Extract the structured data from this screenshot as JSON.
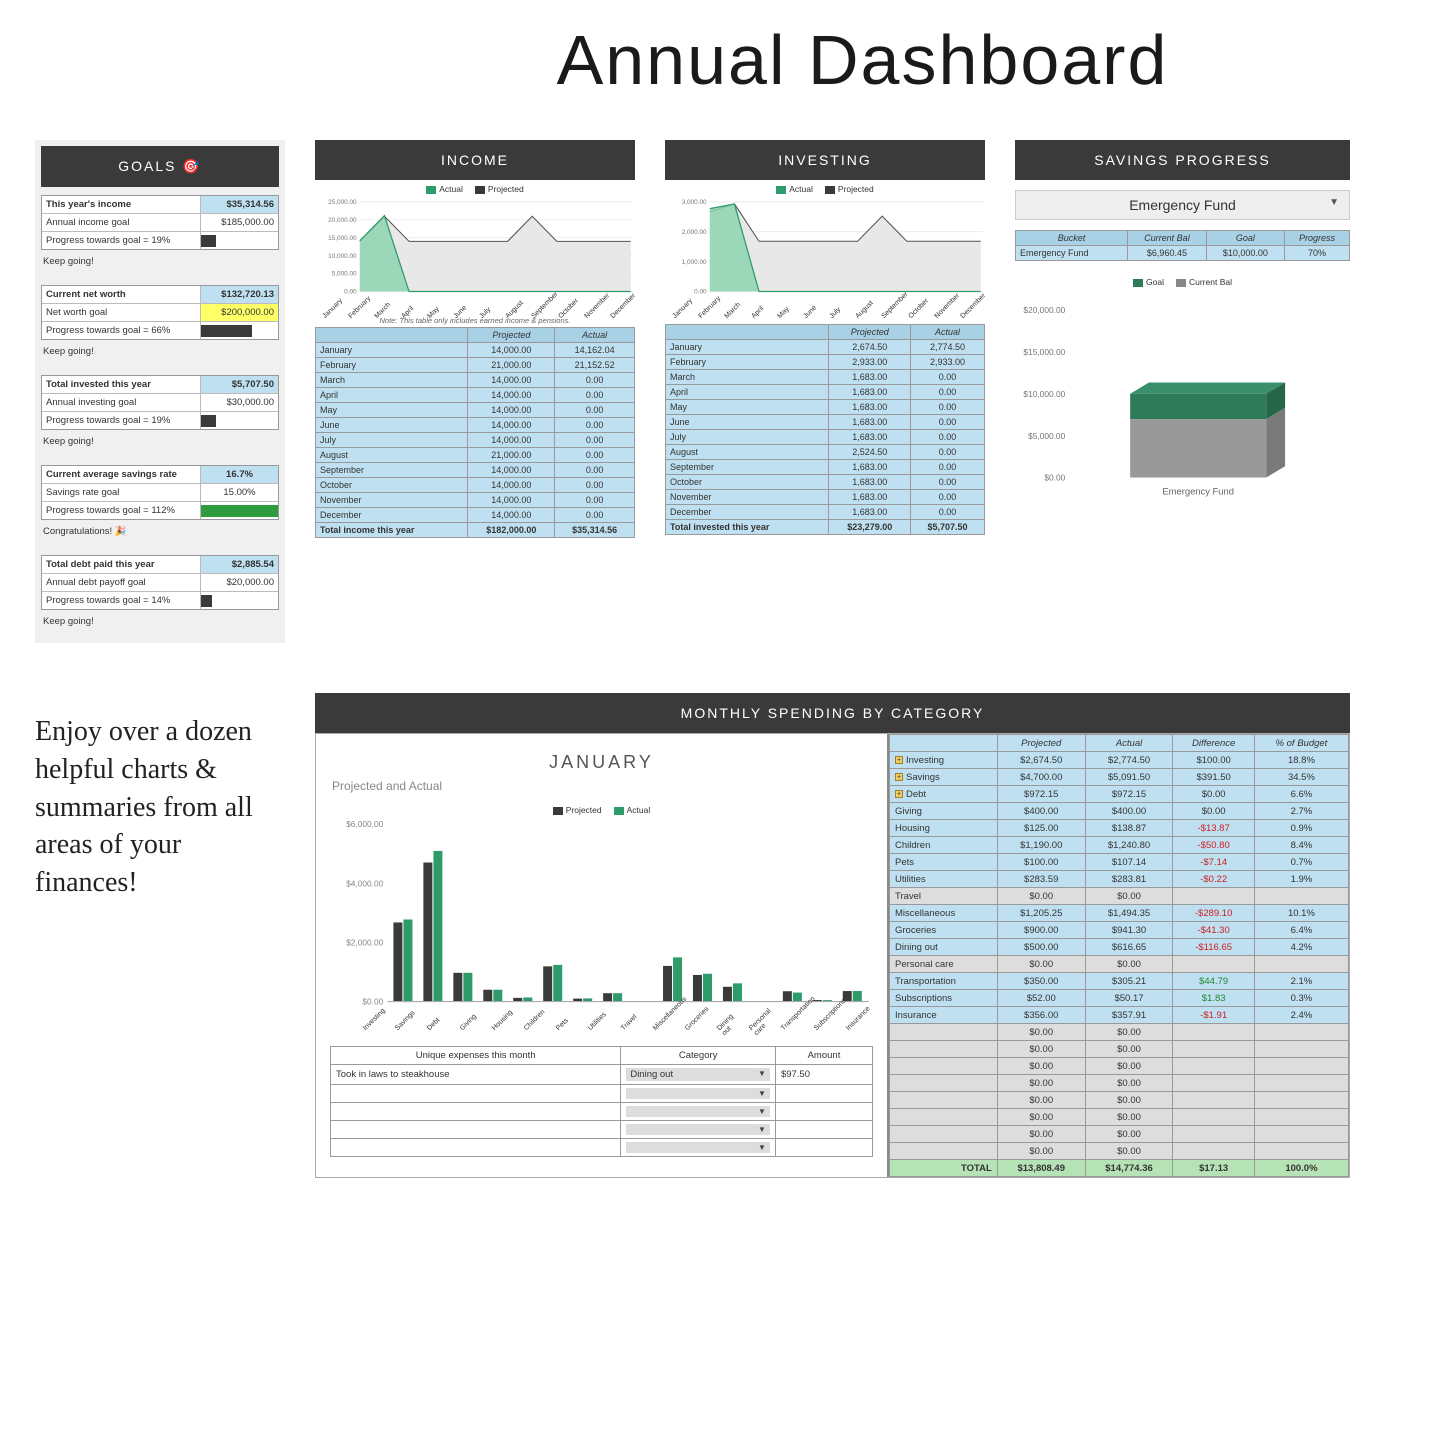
{
  "page_title": "Annual Dashboard",
  "caption": "Enjoy over a dozen helpful charts & summaries from all areas of your finances!",
  "months": [
    "January",
    "February",
    "March",
    "April",
    "May",
    "June",
    "July",
    "August",
    "September",
    "October",
    "November",
    "December"
  ],
  "goals": {
    "header": "GOALS 🎯",
    "blocks": [
      {
        "rows": [
          {
            "label": "This year's income",
            "value": "$35,314.56",
            "bold": true,
            "value_class": "bg-blue"
          },
          {
            "label": "Annual income goal",
            "value": "$185,000.00"
          },
          {
            "label": "Progress towards goal = 19%",
            "bar": true,
            "bar_pct": 19,
            "bar_class": "bg-dark"
          }
        ],
        "msg": "Keep going!"
      },
      {
        "rows": [
          {
            "label": "Current net worth",
            "value": "$132,720.13",
            "bold": true,
            "value_class": "bg-blue"
          },
          {
            "label": "Net worth goal",
            "value": "$200,000.00",
            "value_class": "bg-yellow"
          },
          {
            "label": "Progress towards goal = 66%",
            "bar": true,
            "bar_pct": 66,
            "bar_class": "bg-dark"
          }
        ],
        "msg": "Keep going!"
      },
      {
        "rows": [
          {
            "label": "Total invested this year",
            "value": "$5,707.50",
            "bold": true,
            "value_class": "bg-blue"
          },
          {
            "label": "Annual investing goal",
            "value": "$30,000.00"
          },
          {
            "label": "Progress towards goal = 19%",
            "bar": true,
            "bar_pct": 19,
            "bar_class": "bg-dark"
          }
        ],
        "msg": "Keep going!"
      },
      {
        "rows": [
          {
            "label": "Current average savings rate",
            "value": "16.7%",
            "bold": true,
            "value_class": "bg-blue",
            "center": true
          },
          {
            "label": "Savings rate goal",
            "value": "15.00%",
            "center": true
          },
          {
            "label": "Progress towards goal = 112%",
            "bar": true,
            "bar_pct": 100,
            "bar_class": "bg-green"
          }
        ],
        "msg": "Congratulations! 🎉"
      },
      {
        "rows": [
          {
            "label": "Total debt paid this year",
            "value": "$2,885.54",
            "bold": true,
            "value_class": "bg-blue"
          },
          {
            "label": "Annual debt payoff goal",
            "value": "$20,000.00"
          },
          {
            "label": "Progress towards goal = 14%",
            "bar": true,
            "bar_pct": 14,
            "bar_class": "bg-dark"
          }
        ],
        "msg": "Keep going!"
      }
    ]
  },
  "income": {
    "header": "INCOME",
    "legend": [
      "Actual",
      "Projected"
    ],
    "note": "Note: This table only includes earned income & pensions.",
    "cols": [
      "",
      "Projected",
      "Actual"
    ],
    "rows": [
      [
        "January",
        "14,000.00",
        "14,162.04"
      ],
      [
        "February",
        "21,000.00",
        "21,152.52"
      ],
      [
        "March",
        "14,000.00",
        "0.00"
      ],
      [
        "April",
        "14,000.00",
        "0.00"
      ],
      [
        "May",
        "14,000.00",
        "0.00"
      ],
      [
        "June",
        "14,000.00",
        "0.00"
      ],
      [
        "July",
        "14,000.00",
        "0.00"
      ],
      [
        "August",
        "21,000.00",
        "0.00"
      ],
      [
        "September",
        "14,000.00",
        "0.00"
      ],
      [
        "October",
        "14,000.00",
        "0.00"
      ],
      [
        "November",
        "14,000.00",
        "0.00"
      ],
      [
        "December",
        "14,000.00",
        "0.00"
      ]
    ],
    "total": [
      "Total income this year",
      "$182,000.00",
      "$35,314.56"
    ],
    "chart_data": {
      "type": "area",
      "x": [
        "Jan",
        "Feb",
        "Mar",
        "Apr",
        "May",
        "Jun",
        "Jul",
        "Aug",
        "Sep",
        "Oct",
        "Nov",
        "Dec"
      ],
      "series": [
        {
          "name": "Actual",
          "values": [
            14162,
            21152,
            0,
            0,
            0,
            0,
            0,
            0,
            0,
            0,
            0,
            0
          ]
        },
        {
          "name": "Projected",
          "values": [
            14000,
            21000,
            14000,
            14000,
            14000,
            14000,
            14000,
            21000,
            14000,
            14000,
            14000,
            14000
          ]
        }
      ],
      "ylim": [
        0,
        25000
      ],
      "y_ticks": [
        "0.00",
        "5,000.00",
        "10,000.00",
        "15,000.00",
        "20,000.00",
        "25,000.00"
      ]
    }
  },
  "investing": {
    "header": "INVESTING",
    "legend": [
      "Actual",
      "Projected"
    ],
    "cols": [
      "",
      "Projected",
      "Actual"
    ],
    "rows": [
      [
        "January",
        "2,674.50",
        "2,774.50"
      ],
      [
        "February",
        "2,933.00",
        "2,933.00"
      ],
      [
        "March",
        "1,683.00",
        "0.00"
      ],
      [
        "April",
        "1,683.00",
        "0.00"
      ],
      [
        "May",
        "1,683.00",
        "0.00"
      ],
      [
        "June",
        "1,683.00",
        "0.00"
      ],
      [
        "July",
        "1,683.00",
        "0.00"
      ],
      [
        "August",
        "2,524.50",
        "0.00"
      ],
      [
        "September",
        "1,683.00",
        "0.00"
      ],
      [
        "October",
        "1,683.00",
        "0.00"
      ],
      [
        "November",
        "1,683.00",
        "0.00"
      ],
      [
        "December",
        "1,683.00",
        "0.00"
      ]
    ],
    "total": [
      "Total invested this year",
      "$23,279.00",
      "$5,707.50"
    ],
    "chart_data": {
      "type": "area",
      "x": [
        "Jan",
        "Feb",
        "Mar",
        "Apr",
        "May",
        "Jun",
        "Jul",
        "Aug",
        "Sep",
        "Oct",
        "Nov",
        "Dec"
      ],
      "series": [
        {
          "name": "Actual",
          "values": [
            2774,
            2933,
            0,
            0,
            0,
            0,
            0,
            0,
            0,
            0,
            0,
            0
          ]
        },
        {
          "name": "Projected",
          "values": [
            2674,
            2933,
            1683,
            1683,
            1683,
            1683,
            1683,
            2524,
            1683,
            1683,
            1683,
            1683
          ]
        }
      ],
      "ylim": [
        0,
        3000
      ],
      "y_ticks": [
        "0.00",
        "1,000.00",
        "2,000.00",
        "3,000.00"
      ]
    }
  },
  "savings": {
    "header": "SAVINGS PROGRESS",
    "selector": "Emergency Fund",
    "cols": [
      "Bucket",
      "Current Bal",
      "Goal",
      "Progress"
    ],
    "rows": [
      [
        "Emergency Fund",
        "$6,960.45",
        "$10,000.00",
        "70%"
      ]
    ],
    "legend": [
      "Goal",
      "Current Bal"
    ],
    "chart_data": {
      "type": "bar",
      "categories": [
        "Emergency Fund"
      ],
      "series": [
        {
          "name": "Goal",
          "value": 10000
        },
        {
          "name": "Current Bal",
          "value": 6960.45
        }
      ],
      "ylim": [
        0,
        20000
      ],
      "y_ticks": [
        "$0.00",
        "$5,000.00",
        "$10,000.00",
        "$15,000.00",
        "$20,000.00"
      ]
    }
  },
  "spending": {
    "header": "MONTHLY SPENDING BY CATEGORY",
    "month": "JANUARY",
    "subtitle": "Projected and Actual",
    "legend": [
      "Projected",
      "Actual"
    ],
    "cols": [
      "",
      "Projected",
      "Actual",
      "Difference",
      "% of Budget"
    ],
    "rows": [
      {
        "m": 1,
        "c": "Investing",
        "p": "$2,674.50",
        "a": "$2,774.50",
        "d": "$100.00",
        "b": "18.8%"
      },
      {
        "m": 1,
        "c": "Savings",
        "p": "$4,700.00",
        "a": "$5,091.50",
        "d": "$391.50",
        "b": "34.5%"
      },
      {
        "m": 1,
        "c": "Debt",
        "p": "$972.15",
        "a": "$972.15",
        "d": "$0.00",
        "b": "6.6%"
      },
      {
        "m": 0,
        "c": "Giving",
        "p": "$400.00",
        "a": "$400.00",
        "d": "$0.00",
        "b": "2.7%"
      },
      {
        "m": 0,
        "c": "Housing",
        "p": "$125.00",
        "a": "$138.87",
        "d": "-$13.87",
        "dn": 1,
        "b": "0.9%"
      },
      {
        "m": 0,
        "c": "Children",
        "p": "$1,190.00",
        "a": "$1,240.80",
        "d": "-$50.80",
        "dn": 1,
        "b": "8.4%"
      },
      {
        "m": 0,
        "c": "Pets",
        "p": "$100.00",
        "a": "$107.14",
        "d": "-$7.14",
        "dn": 1,
        "b": "0.7%"
      },
      {
        "m": 0,
        "c": "Utilities",
        "p": "$283.59",
        "a": "$283.81",
        "d": "-$0.22",
        "dn": 1,
        "b": "1.9%"
      },
      {
        "m": 0,
        "grey": 1,
        "c": "Travel",
        "p": "$0.00",
        "a": "$0.00",
        "d": "",
        "b": ""
      },
      {
        "m": 0,
        "c": "Miscellaneous",
        "p": "$1,205.25",
        "a": "$1,494.35",
        "d": "-$289.10",
        "dn": 1,
        "b": "10.1%"
      },
      {
        "m": 0,
        "c": "Groceries",
        "p": "$900.00",
        "a": "$941.30",
        "d": "-$41.30",
        "dn": 1,
        "b": "6.4%"
      },
      {
        "m": 0,
        "c": "Dining out",
        "p": "$500.00",
        "a": "$616.65",
        "d": "-$116.65",
        "dn": 1,
        "b": "4.2%"
      },
      {
        "m": 0,
        "grey": 1,
        "c": "Personal care",
        "p": "$0.00",
        "a": "$0.00",
        "d": "",
        "b": ""
      },
      {
        "m": 0,
        "c": "Transportation",
        "p": "$350.00",
        "a": "$305.21",
        "d": "$44.79",
        "dp": 1,
        "b": "2.1%"
      },
      {
        "m": 0,
        "c": "Subscriptions",
        "p": "$52.00",
        "a": "$50.17",
        "d": "$1.83",
        "dp": 1,
        "b": "0.3%"
      },
      {
        "m": 0,
        "c": "Insurance",
        "p": "$356.00",
        "a": "$357.91",
        "d": "-$1.91",
        "dn": 1,
        "b": "2.4%"
      },
      {
        "m": 0,
        "grey": 1,
        "c": "",
        "p": "$0.00",
        "a": "$0.00",
        "d": "",
        "b": ""
      },
      {
        "m": 0,
        "grey": 1,
        "c": "",
        "p": "$0.00",
        "a": "$0.00",
        "d": "",
        "b": ""
      },
      {
        "m": 0,
        "grey": 1,
        "c": "",
        "p": "$0.00",
        "a": "$0.00",
        "d": "",
        "b": ""
      },
      {
        "m": 0,
        "grey": 1,
        "c": "",
        "p": "$0.00",
        "a": "$0.00",
        "d": "",
        "b": ""
      },
      {
        "m": 0,
        "grey": 1,
        "c": "",
        "p": "$0.00",
        "a": "$0.00",
        "d": "",
        "b": ""
      },
      {
        "m": 0,
        "grey": 1,
        "c": "",
        "p": "$0.00",
        "a": "$0.00",
        "d": "",
        "b": ""
      },
      {
        "m": 0,
        "grey": 1,
        "c": "",
        "p": "$0.00",
        "a": "$0.00",
        "d": "",
        "b": ""
      },
      {
        "m": 0,
        "grey": 1,
        "c": "",
        "p": "$0.00",
        "a": "$0.00",
        "d": "",
        "b": ""
      }
    ],
    "total": {
      "label": "TOTAL",
      "p": "$13,808.49",
      "a": "$14,774.36",
      "d": "$17.13",
      "b": "100.0%"
    },
    "chart_data": {
      "type": "bar",
      "categories": [
        "Investing",
        "Savings",
        "Debt",
        "Giving",
        "Housing",
        "Children",
        "Pets",
        "Utilities",
        "Travel",
        "Miscellaneous",
        "Groceries",
        "Dining out",
        "Personal care",
        "Transportation",
        "Subscriptions",
        "Insurance"
      ],
      "series": [
        {
          "name": "Projected",
          "values": [
            2674.5,
            4700.0,
            972.15,
            400.0,
            125.0,
            1190.0,
            100.0,
            283.59,
            0,
            1205.25,
            900.0,
            500.0,
            0,
            350.0,
            52.0,
            356.0
          ]
        },
        {
          "name": "Actual",
          "values": [
            2774.5,
            5091.5,
            972.15,
            400.0,
            138.87,
            1240.8,
            107.14,
            283.81,
            0,
            1494.35,
            941.3,
            616.65,
            0,
            305.21,
            50.17,
            357.91
          ]
        }
      ],
      "ylim": [
        0,
        6000
      ],
      "y_ticks": [
        "$0.00",
        "$2,000.00",
        "$4,000.00",
        "$6,000.00"
      ]
    },
    "unique": {
      "cols": [
        "Unique expenses this month",
        "Category",
        "Amount"
      ],
      "rows": [
        {
          "desc": "Took in laws to steakhouse",
          "cat": "Dining out",
          "amt": "$97.50"
        },
        {
          "desc": "",
          "cat": "",
          "amt": ""
        },
        {
          "desc": "",
          "cat": "",
          "amt": ""
        },
        {
          "desc": "",
          "cat": "",
          "amt": ""
        },
        {
          "desc": "",
          "cat": "",
          "amt": ""
        }
      ]
    }
  }
}
